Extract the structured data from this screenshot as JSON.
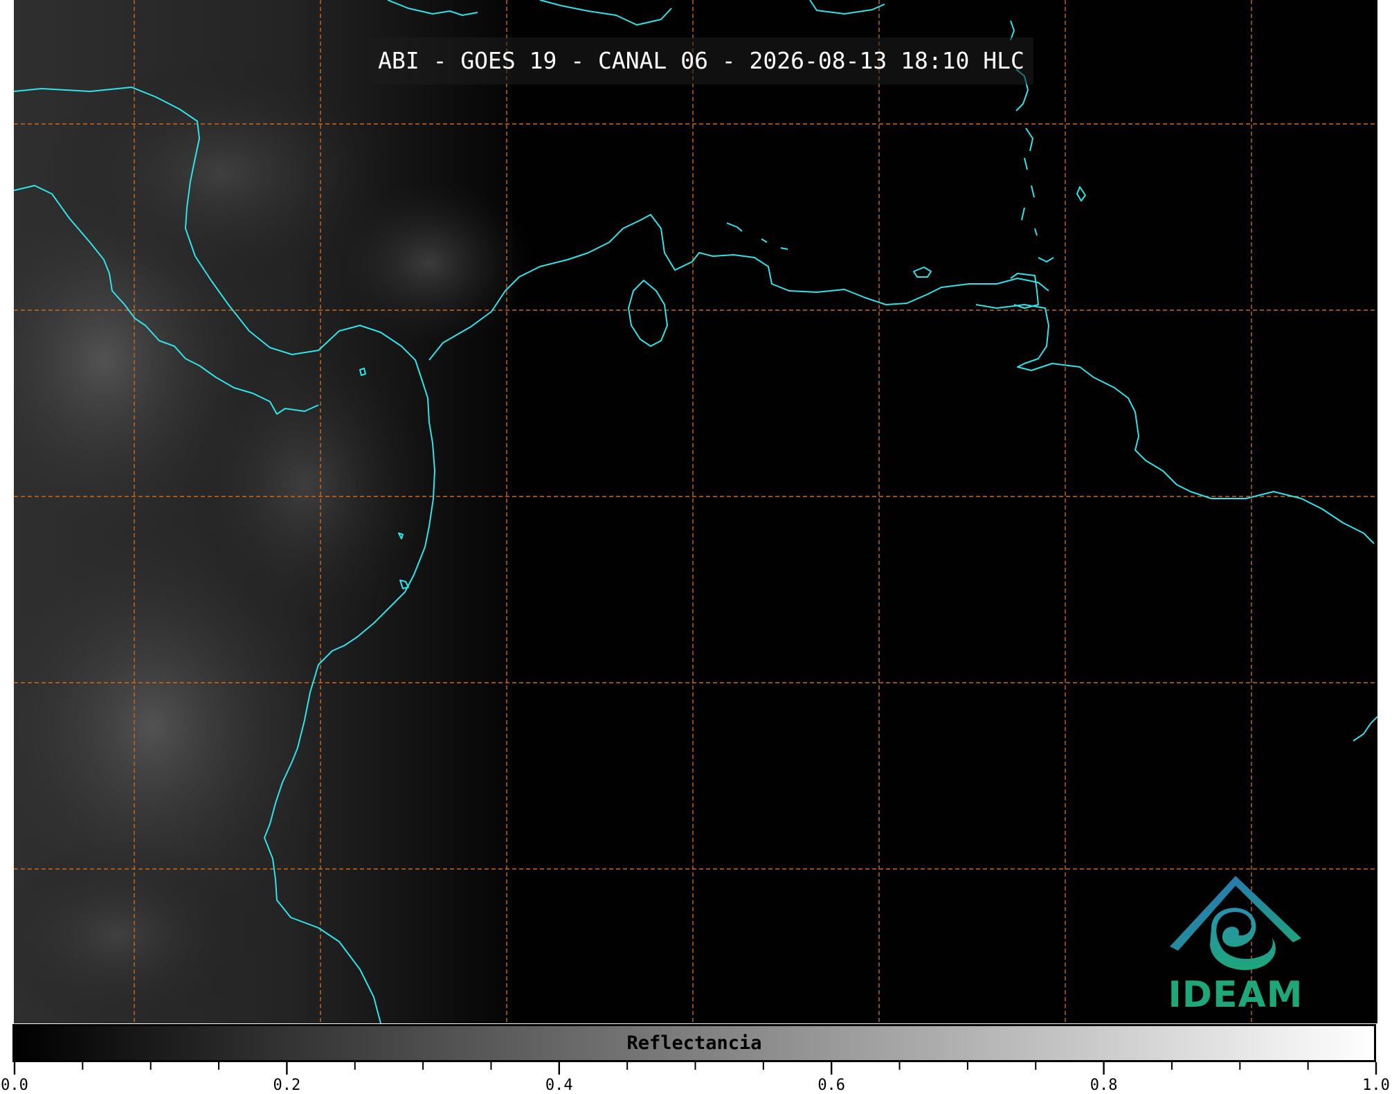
{
  "map": {
    "title": "ABI - GOES 19 - CANAL 06 - 2026-08-13 18:10 HLC",
    "background_color": "#010101",
    "coastline_color": "#2fe4ea",
    "gridline_color": "#c96a1e"
  },
  "colorbar": {
    "label": "Reflectancia",
    "range": [
      0.0,
      1.0
    ],
    "colormap": [
      "#000000",
      "#ffffff"
    ],
    "tick_labels": [
      "0.0",
      "0.2",
      "0.4",
      "0.6",
      "0.8",
      "1.0"
    ]
  },
  "logo": {
    "text": "IDEAM",
    "text_color": "#1fa67a",
    "roof_color": "#2a6fc0"
  }
}
